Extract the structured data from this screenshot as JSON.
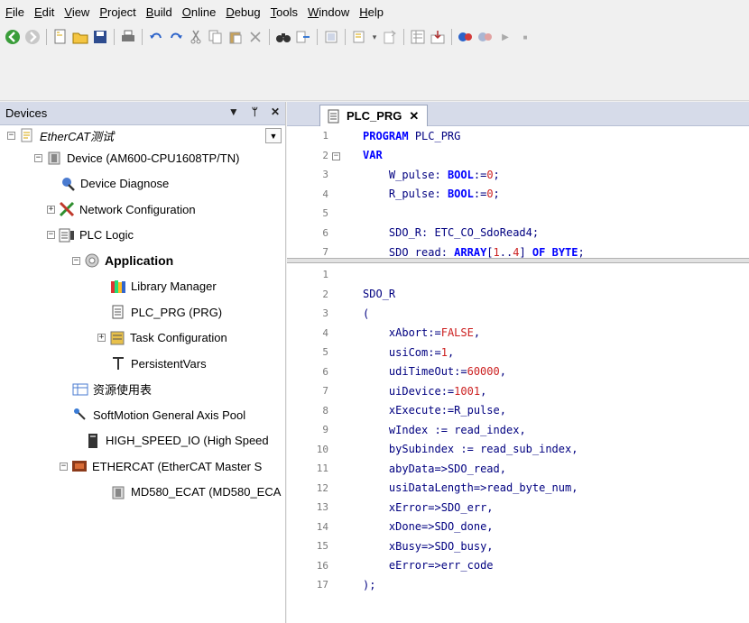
{
  "menu": [
    {
      "label": "File",
      "u": "F",
      "rest": "ile"
    },
    {
      "label": "Edit",
      "u": "E",
      "rest": "dit"
    },
    {
      "label": "View",
      "u": "V",
      "rest": "iew"
    },
    {
      "label": "Project",
      "u": "P",
      "rest": "roject"
    },
    {
      "label": "Build",
      "u": "B",
      "rest": "uild"
    },
    {
      "label": "Online",
      "u": "O",
      "rest": "nline"
    },
    {
      "label": "Debug",
      "u": "D",
      "rest": "ebug"
    },
    {
      "label": "Tools",
      "u": "T",
      "rest": "ools"
    },
    {
      "label": "Window",
      "u": "W",
      "rest": "indow"
    },
    {
      "label": "Help",
      "u": "H",
      "rest": "elp"
    }
  ],
  "devices_panel": {
    "title": "Devices",
    "pin_glyph": "▾  ⊥",
    "close_glyph": "✕",
    "root_label": "EtherCAT测试",
    "items": [
      {
        "label": "Device (AM600-CPU1608TP/TN)",
        "icon": "device-icon"
      },
      {
        "label": "Device Diagnose",
        "icon": "diagnose-icon"
      },
      {
        "label": "Network Configuration",
        "icon": "network-config-icon"
      },
      {
        "label": "PLC Logic",
        "icon": "plc-logic-icon"
      },
      {
        "label": "Application",
        "icon": "application-gear-icon"
      },
      {
        "label": "Library Manager",
        "icon": "library-icon"
      },
      {
        "label": "PLC_PRG (PRG)",
        "icon": "pou-icon"
      },
      {
        "label": "Task Configuration",
        "icon": "task-config-icon"
      },
      {
        "label": "PersistentVars",
        "icon": "persistent-vars-icon"
      },
      {
        "label": "资源使用表",
        "icon": "resource-table-icon"
      },
      {
        "label": "SoftMotion General Axis Pool",
        "icon": "axis-pool-icon"
      },
      {
        "label": "HIGH_SPEED_IO (High Speed",
        "icon": "io-module-icon"
      },
      {
        "label": "ETHERCAT (EtherCAT Master S",
        "icon": "ethercat-master-icon"
      },
      {
        "label": "MD580_ECAT (MD580_ECA",
        "icon": "ecat-slave-icon"
      }
    ]
  },
  "editor": {
    "tab_label": "PLC_PRG",
    "tab_close": "✕",
    "top_lines": [
      {
        "n": "1",
        "html": "PROGRAM PLC_PRG"
      },
      {
        "n": "2",
        "html": "VAR"
      },
      {
        "n": "3",
        "html": "    W_pulse: BOOL:=0;"
      },
      {
        "n": "4",
        "html": "    R_pulse: BOOL:=0;"
      },
      {
        "n": "5",
        "html": ""
      },
      {
        "n": "6",
        "html": "    SDO_R: ETC_CO_SdoRead4;"
      },
      {
        "n": "7",
        "html": "    SDO_read: ARRAY[1..4] OF BYTE;"
      }
    ],
    "bottom_lines": [
      {
        "n": "1",
        "html": ""
      },
      {
        "n": "2",
        "html": "SDO_R"
      },
      {
        "n": "3",
        "html": "("
      },
      {
        "n": "4",
        "html": "    xAbort:=FALSE,"
      },
      {
        "n": "5",
        "html": "    usiCom:=1,"
      },
      {
        "n": "6",
        "html": "    udiTimeOut:=60000,"
      },
      {
        "n": "7",
        "html": "    uiDevice:=1001,"
      },
      {
        "n": "8",
        "html": "    xExecute:=R_pulse,"
      },
      {
        "n": "9",
        "html": "    wIndex := read_index,"
      },
      {
        "n": "10",
        "html": "    bySubindex := read_sub_index,"
      },
      {
        "n": "11",
        "html": "    abyData=>SDO_read,"
      },
      {
        "n": "12",
        "html": "    usiDataLength=>read_byte_num,"
      },
      {
        "n": "13",
        "html": "    xError=>SDO_err,"
      },
      {
        "n": "14",
        "html": "    xDone=>SDO_done,"
      },
      {
        "n": "15",
        "html": "    xBusy=>SDO_busy,"
      },
      {
        "n": "16",
        "html": "    eError=>err_code"
      },
      {
        "n": "17",
        "html": ");"
      }
    ]
  }
}
